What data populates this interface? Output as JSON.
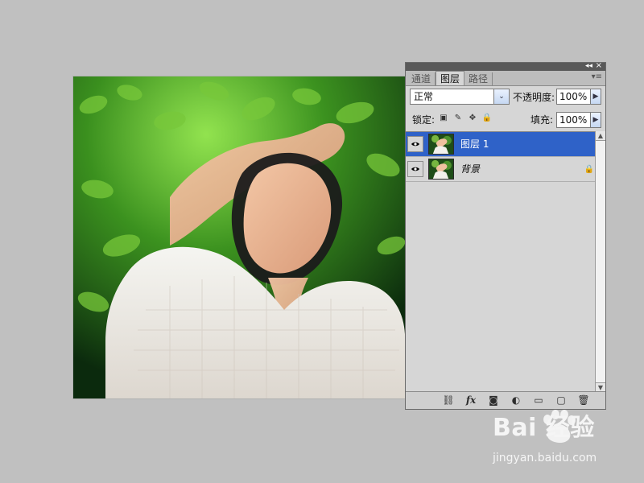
{
  "canvas": {
    "background": "#c0c0c0"
  },
  "panel": {
    "tabs": [
      {
        "label": "通道",
        "active": false
      },
      {
        "label": "图层",
        "active": true
      },
      {
        "label": "路径",
        "active": false
      }
    ],
    "blend_mode": "正常",
    "opacity_label": "不透明度:",
    "opacity_value": "100%",
    "lock_label": "锁定:",
    "fill_label": "填充:",
    "fill_value": "100%",
    "layers": [
      {
        "name": "图层 1",
        "selected": true,
        "locked": false
      },
      {
        "name": "背景",
        "selected": false,
        "locked": true
      }
    ],
    "icons": {
      "collapse": "double-chevron-icon",
      "close": "close-icon",
      "menu": "panel-menu-icon",
      "dropdown": "chevron-down-icon",
      "spin": "chevron-right-icon",
      "lock_transparent": "lock-transparent-pixels-icon",
      "lock_image": "brush-icon",
      "lock_position": "move-icon",
      "lock_all": "lock-icon",
      "eye": "eye-icon",
      "layer_lock": "padlock-icon",
      "link": "link-layers-icon",
      "fx": "fx-icon",
      "mask": "layer-mask-icon",
      "adjustment": "adjustment-layer-icon",
      "group": "folder-icon",
      "new_layer": "new-layer-icon",
      "trash": "trash-icon"
    },
    "colors": {
      "selected": "#2f62c8",
      "panel": "#d6d6d6",
      "topbar": "#595959"
    }
  },
  "watermark": {
    "brand": "Bai  经验",
    "url": "jingyan.baidu.com"
  }
}
